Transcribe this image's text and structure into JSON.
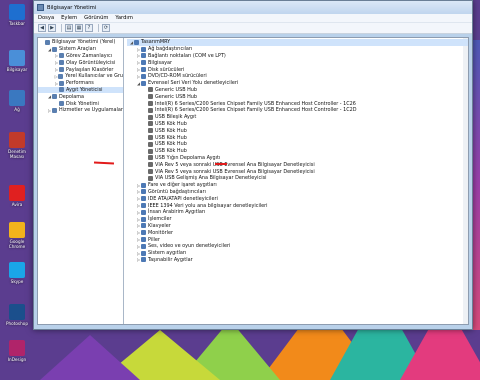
{
  "window": {
    "title": "Bilgisayar Yönetimi"
  },
  "menu": [
    "Dosya",
    "Eylem",
    "Görünüm",
    "Yardım"
  ],
  "desktop_icons": [
    {
      "label": "Taskbar",
      "color": "#1e6fd0"
    },
    {
      "label": "Bilgisayar",
      "color": "#4a8fd8"
    },
    {
      "label": "Ağ",
      "color": "#3a78c0"
    },
    {
      "label": "Denetim Masası",
      "color": "#c23a2a"
    },
    {
      "label": "Avira",
      "color": "#e02020"
    },
    {
      "label": "Google Chrome",
      "color": "#f2b31c"
    },
    {
      "label": "Skype",
      "color": "#1aa6e8"
    },
    {
      "label": "Photoshop",
      "color": "#1b4f8c"
    },
    {
      "label": "InDesign",
      "color": "#b0246a"
    }
  ],
  "left_tree": [
    {
      "label": "Bilgisayar Yönetimi (Yerel)",
      "level": 0,
      "exp": ""
    },
    {
      "label": "Sistem Araçları",
      "level": 1,
      "exp": "◢"
    },
    {
      "label": "Görev Zamanlayıcı",
      "level": 2,
      "exp": "▷"
    },
    {
      "label": "Olay Görüntüleyicisi",
      "level": 2,
      "exp": "▷"
    },
    {
      "label": "Paylaşılan Klasörler",
      "level": 2,
      "exp": "▷"
    },
    {
      "label": "Yerel Kullanıcılar ve Gru",
      "level": 2,
      "exp": "▷"
    },
    {
      "label": "Performans",
      "level": 2,
      "exp": "▷"
    },
    {
      "label": "Aygıt Yöneticisi",
      "level": 2,
      "exp": "",
      "selected": true
    },
    {
      "label": "Depolama",
      "level": 1,
      "exp": "◢"
    },
    {
      "label": "Disk Yönetimi",
      "level": 2,
      "exp": ""
    },
    {
      "label": "Hizmetler ve Uygulamalar",
      "level": 1,
      "exp": "▷"
    }
  ],
  "device_tree": [
    {
      "label": "TasarımMRY",
      "level": 0,
      "exp": "◢",
      "selected": true
    },
    {
      "label": "Ağ bağdaştırıcıları",
      "level": 1,
      "exp": "▷"
    },
    {
      "label": "Bağlantı noktaları (COM ve LPT)",
      "level": 1,
      "exp": "▷"
    },
    {
      "label": "Bilgisayar",
      "level": 1,
      "exp": "▷"
    },
    {
      "label": "Disk sürücüleri",
      "level": 1,
      "exp": "▷"
    },
    {
      "label": "DVD/CD-ROM sürücüleri",
      "level": 1,
      "exp": "▷"
    },
    {
      "label": "Evrensel Seri Veri Yolu denetleyicileri",
      "level": 1,
      "exp": "◢"
    },
    {
      "label": "Generic USB Hub",
      "level": 2,
      "exp": ""
    },
    {
      "label": "Generic USB Hub",
      "level": 2,
      "exp": ""
    },
    {
      "label": "Intel(R) 6 Series/C200 Series Chipset Family USB Enhanced Host Controller - 1C26",
      "level": 2,
      "exp": ""
    },
    {
      "label": "Intel(R) 6 Series/C200 Series Chipset Family USB Enhanced Host Controller - 1C2D",
      "level": 2,
      "exp": ""
    },
    {
      "label": "USB Bileşik Aygıt",
      "level": 2,
      "exp": ""
    },
    {
      "label": "USB Kök Hub",
      "level": 2,
      "exp": ""
    },
    {
      "label": "USB Kök Hub",
      "level": 2,
      "exp": ""
    },
    {
      "label": "USB Kök Hub",
      "level": 2,
      "exp": ""
    },
    {
      "label": "USB Kök Hub",
      "level": 2,
      "exp": ""
    },
    {
      "label": "USB Kök Hub",
      "level": 2,
      "exp": ""
    },
    {
      "label": "USB Yığın Depolama Aygıtı",
      "level": 2,
      "exp": ""
    },
    {
      "label": "VIA Rev 5 veya sonraki USB Evrensel Ana Bilgisayar Denetleyicisi",
      "level": 2,
      "exp": ""
    },
    {
      "label": "VIA Rev 5 veya sonraki USB Evrensel Ana Bilgisayar Denetleyicisi",
      "level": 2,
      "exp": ""
    },
    {
      "label": "VIA USB Gelişmiş Ana Bilgisayar Denetleyicisi",
      "level": 2,
      "exp": ""
    },
    {
      "label": "Fare ve diğer işaret aygıtları",
      "level": 1,
      "exp": "▷"
    },
    {
      "label": "Görüntü bağdaştırıcıları",
      "level": 1,
      "exp": "▷"
    },
    {
      "label": "IDE ATA/ATAPI denetleyicileri",
      "level": 1,
      "exp": "▷"
    },
    {
      "label": "IEEE 1394 Veri yolu ana bilgisayar denetleyicileri",
      "level": 1,
      "exp": "▷"
    },
    {
      "label": "İnsan Arabirim Aygıtları",
      "level": 1,
      "exp": "▷"
    },
    {
      "label": "İşlemciler",
      "level": 1,
      "exp": "▷"
    },
    {
      "label": "Klavyeler",
      "level": 1,
      "exp": "▷"
    },
    {
      "label": "Monitörler",
      "level": 1,
      "exp": "▷"
    },
    {
      "label": "Piller",
      "level": 1,
      "exp": "▷"
    },
    {
      "label": "Ses, video ve oyun denetleyicileri",
      "level": 1,
      "exp": "▷"
    },
    {
      "label": "Sistem aygıtları",
      "level": 1,
      "exp": "▷"
    },
    {
      "label": "Taşınabilir Aygıtlar",
      "level": 1,
      "exp": "▷"
    }
  ]
}
